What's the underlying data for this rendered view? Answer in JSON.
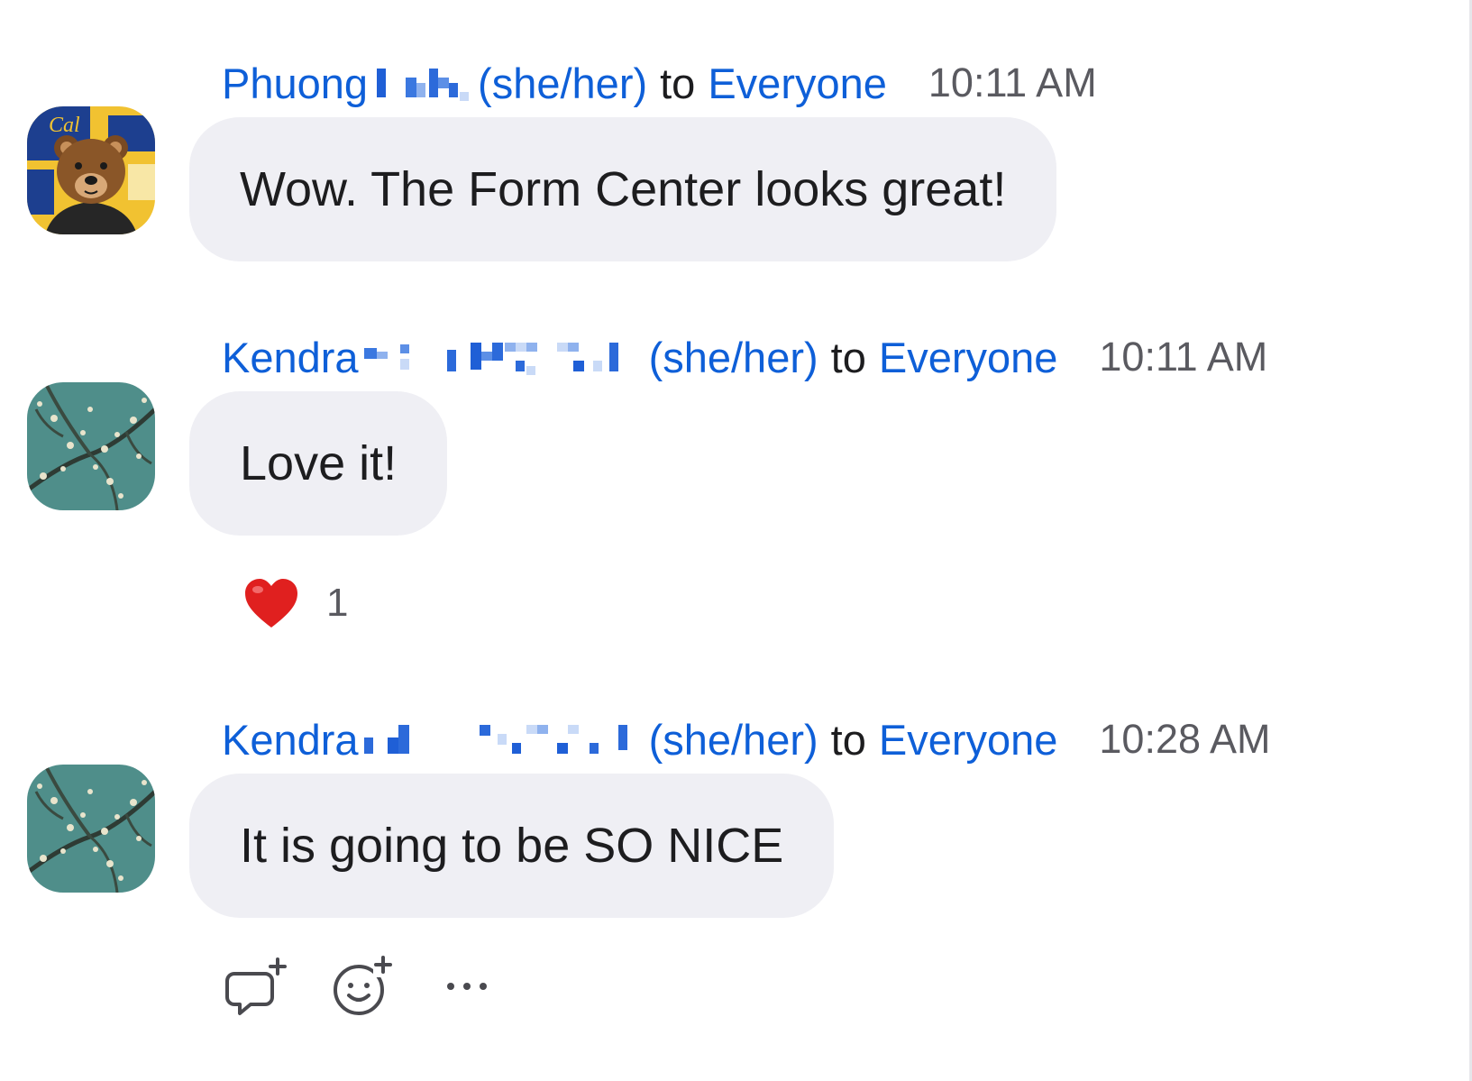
{
  "messages": [
    {
      "sender_first": "Phuong",
      "pronouns": "(she/her)",
      "to_word": "to",
      "recipient": "Everyone",
      "time": "10:11 AM",
      "text": "Wow. The Form Center looks great!",
      "avatar": "bear-emoji-avatar"
    },
    {
      "sender_first": "Kendra",
      "pronouns": "(she/her)",
      "to_word": "to",
      "recipient": "Everyone",
      "time": "10:11 AM",
      "text": "Love it!",
      "avatar": "almond-blossom-avatar",
      "reaction": {
        "emoji": "heart-icon",
        "count": "1"
      }
    },
    {
      "sender_first": "Kendra",
      "pronouns": "(she/her)",
      "to_word": "to",
      "recipient": "Everyone",
      "time": "10:28 AM",
      "text": "It is going to be SO NICE",
      "avatar": "almond-blossom-avatar"
    }
  ],
  "actions": [
    {
      "icon": "reply-thread-icon"
    },
    {
      "icon": "add-reaction-icon"
    },
    {
      "icon": "more-options-icon"
    }
  ],
  "colors": {
    "sender": "#0e5fd8",
    "bubble": "#efeff4",
    "text": "#1d1d1f",
    "time": "#5a5a60",
    "heart": "#e0201f"
  }
}
